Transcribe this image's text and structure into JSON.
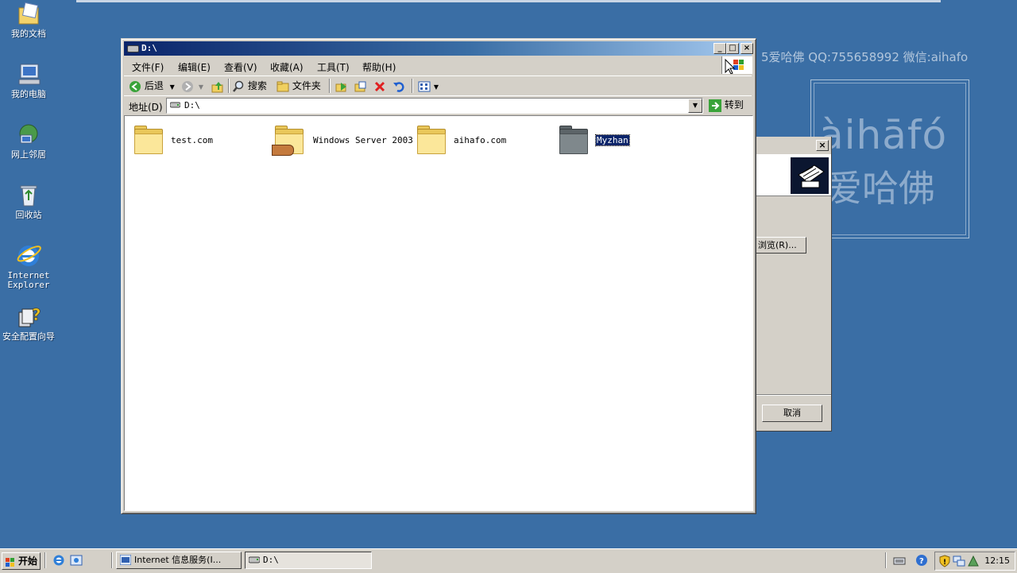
{
  "desktop": {
    "icons": [
      {
        "label": "我的文档",
        "icon": "my-documents-icon"
      },
      {
        "label": "我的电脑",
        "icon": "my-computer-icon"
      },
      {
        "label": "网上邻居",
        "icon": "network-places-icon"
      },
      {
        "label": "回收站",
        "icon": "recycle-bin-icon"
      },
      {
        "label": "Internet Explorer",
        "icon": "internet-explorer-icon"
      },
      {
        "label": "安全配置向导",
        "icon": "security-wizard-icon"
      }
    ],
    "watermark": {
      "text": "5爱哈佛 QQ:755658992 微信:aihafo",
      "logo_pinyin": "àihāfó",
      "logo_han": "爱哈佛"
    }
  },
  "explorer": {
    "title": "D:\\",
    "menu": [
      "文件(F)",
      "编辑(E)",
      "查看(V)",
      "收藏(A)",
      "工具(T)",
      "帮助(H)"
    ],
    "toolbar": {
      "back": "后退",
      "search": "搜索",
      "folders": "文件夹"
    },
    "address": {
      "label": "地址(D)",
      "value": "D:\\",
      "go": "转到"
    },
    "files": [
      {
        "name": "test.com",
        "kind": "folder"
      },
      {
        "name": "Windows Server 2003",
        "kind": "shared-folder"
      },
      {
        "name": "aihafo.com",
        "kind": "folder"
      },
      {
        "name": "Myzhan",
        "kind": "folder-selected"
      }
    ]
  },
  "dialog": {
    "browse": "浏览(R)...",
    "cancel": "取消"
  },
  "taskbar": {
    "start": "开始",
    "tasks": [
      {
        "label": "Internet 信息服务(I...",
        "active": false
      },
      {
        "label": "D:\\",
        "active": true
      }
    ],
    "clock": "12:15"
  },
  "colors": {
    "desktop": "#3a6ea5",
    "title_active": "#0a246a",
    "selection": "#0a246a"
  }
}
